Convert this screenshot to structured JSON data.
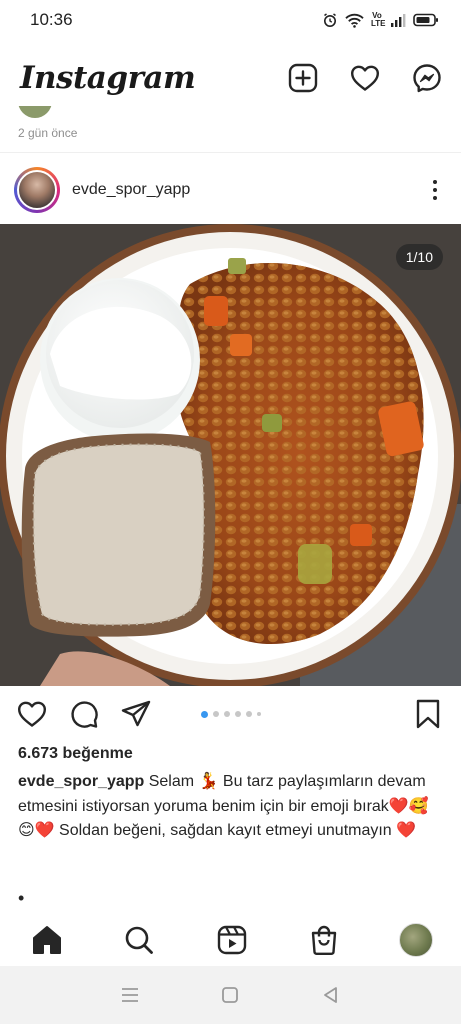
{
  "status_bar": {
    "time": "10:36"
  },
  "header": {
    "logo_text": "Instagram",
    "icons": [
      "new-post-icon",
      "heart-icon",
      "messenger-icon"
    ]
  },
  "previous_post": {
    "time_ago": "2 gün önce"
  },
  "post": {
    "username": "evde_spor_yapp",
    "image_counter": "1/10",
    "carousel": {
      "total_dots": 6,
      "active_index": 0
    },
    "likes": "6.673 beğenme",
    "caption_user": "evde_spor_yapp",
    "caption_text": "Selam 💃 Bu tarz paylaşımların devam etmesini istiyorsan yoruma benim için bir emoji bırak❤️🥰 😊❤️ Soldan beğeni, sağdan kayıt etmeyi unutmayın ❤️",
    "caption_more_dot": "•"
  },
  "bottom_nav": {
    "items": [
      "home-icon",
      "search-icon",
      "reels-icon",
      "shop-icon",
      "profile-avatar"
    ]
  },
  "system_nav": {
    "items": [
      "menu-icon",
      "home-square-icon",
      "back-icon"
    ]
  },
  "colors": {
    "accent_blue": "#3897f0",
    "text": "#262626",
    "muted": "#8e8e8e"
  }
}
